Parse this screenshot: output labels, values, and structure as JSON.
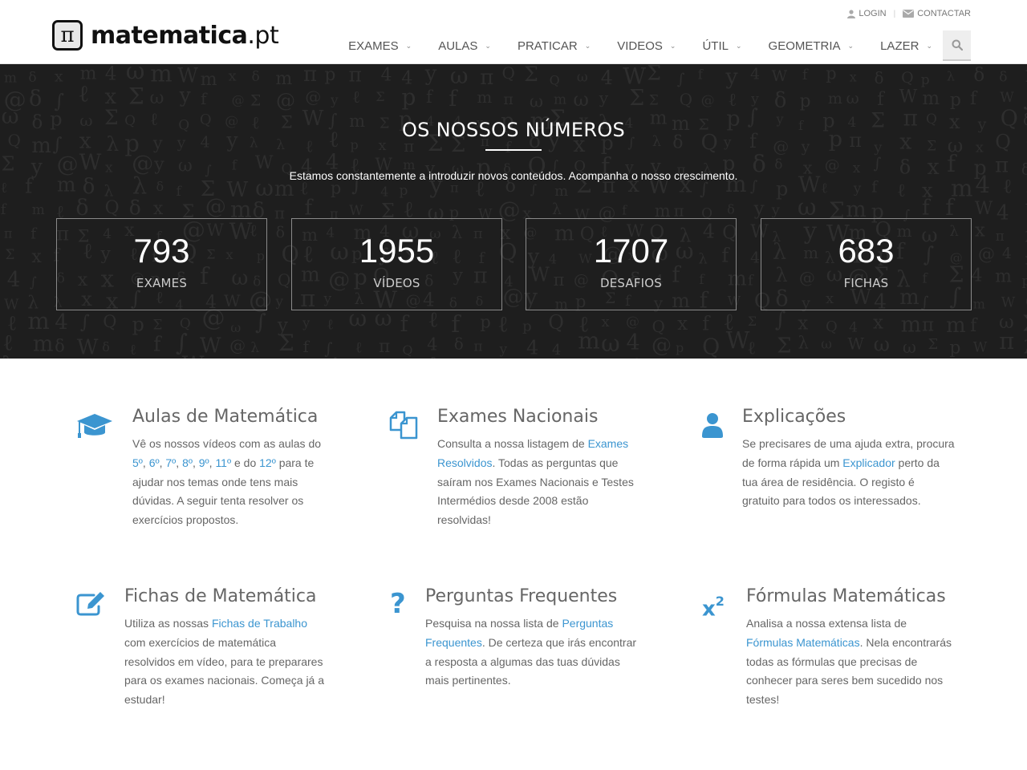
{
  "brand": {
    "logo_glyph": "π",
    "name_bold": "matematica",
    "name_light": ".pt",
    "accent": "#3b95d0"
  },
  "topbar": {
    "login": "LOGIN",
    "contact": "CONTACTAR"
  },
  "nav": {
    "items": [
      "EXAMES",
      "AULAS",
      "PRATICAR",
      "VIDEOS",
      "ÚTIL",
      "GEOMETRIA",
      "LAZER"
    ],
    "search_icon": "search-icon"
  },
  "hero": {
    "title": "OS NOSSOS NÚMEROS",
    "subtitle": "Estamos constantemente a introduzir novos conteúdos. Acompanha o nosso crescimento.",
    "stats": [
      {
        "number": "793",
        "label": "EXAMES"
      },
      {
        "number": "1955",
        "label": "VÍDEOS"
      },
      {
        "number": "1707",
        "label": "DESAFIOS"
      },
      {
        "number": "683",
        "label": "FICHAS"
      }
    ]
  },
  "features": {
    "aulas": {
      "icon": "graduation-cap-icon",
      "title": "Aulas de Matemática",
      "t1": "Vê os nossos vídeos com as aulas do ",
      "g5": "5º",
      "c1": ", ",
      "g6": "6º",
      "c2": ", ",
      "g7": "7º",
      "c3": ", ",
      "g8": "8º",
      "c4": ", ",
      "g9": "9º",
      "c5": ", ",
      "g11": "11º",
      "c6": " e do ",
      "g12": "12º",
      "t2": " para te ajudar nos temas onde tens mais dúvidas. A seguir tenta resolver os exercícios propostos."
    },
    "exames": {
      "icon": "files-icon",
      "title": "Exames Nacionais",
      "t1": "Consulta a nossa listagem de ",
      "link": "Exames Resolvidos",
      "t2": ". Todas as perguntas que saíram nos Exames Nacionais e Testes Intermédios desde 2008 estão resolvidas!"
    },
    "explicacoes": {
      "icon": "user-icon",
      "title": "Explicações",
      "t1": "Se precisares de uma ajuda extra, procura de forma rápida um ",
      "link": "Explicador",
      "t2": " perto da tua área de residência. O registo é gratuito para todos os interessados."
    },
    "fichas": {
      "icon": "edit-icon",
      "title": "Fichas de Matemática",
      "t1": "Utiliza as nossas ",
      "link": "Fichas de Trabalho",
      "t2": " com exercícios de matemática resolvidos em vídeo, para te preparares para os exames nacionais. Começa já a estudar!"
    },
    "perguntas": {
      "icon": "question-icon",
      "title": "Perguntas Frequentes",
      "t1": "Pesquisa na nossa lista de ",
      "link": "Perguntas Frequentes",
      "t2": ". De certeza que irás encontrar a resposta a algumas das tuas dúvidas mais pertinentes."
    },
    "formulas": {
      "icon": "superscript-icon",
      "title": "Fórmulas Matemáticas",
      "t1": "Analisa a nossa extensa lista de ",
      "link": "Fórmulas Matemáticas",
      "t2": ". Nela encontrarás todas as fórmulas que precisas de conhecer para seres bem sucedido nos testes!"
    }
  }
}
